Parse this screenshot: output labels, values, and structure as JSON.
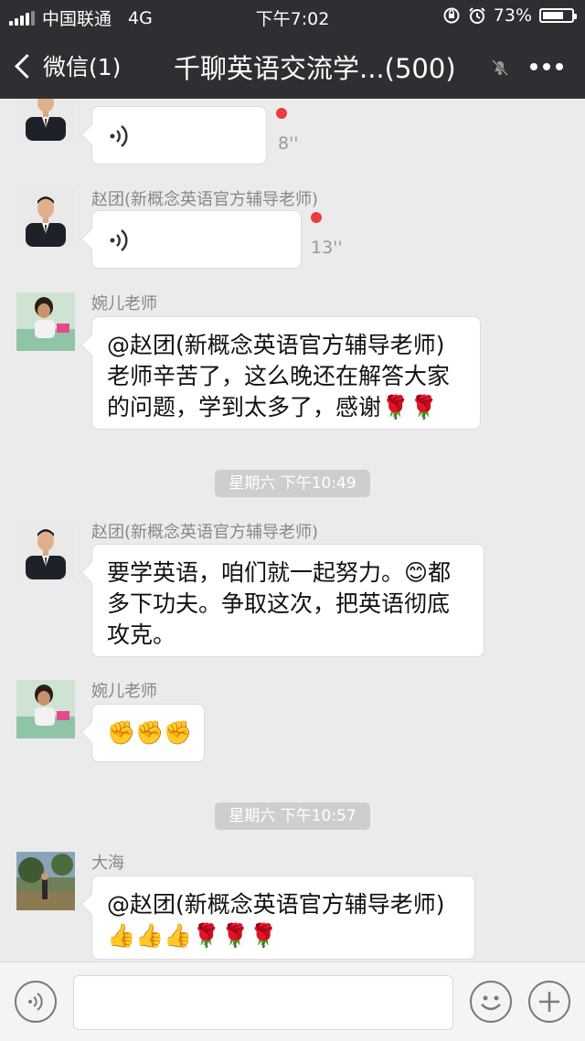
{
  "status_bar": {
    "carrier": "中国联通",
    "network": "4G",
    "time": "下午7:02",
    "battery": "73%",
    "battery_level": 0.73
  },
  "nav": {
    "back_label": "微信(1)",
    "title": "千聊英语交流学...(500)"
  },
  "messages": [
    {
      "type": "voice",
      "duration": "8''",
      "unread": true
    },
    {
      "type": "voice",
      "sender": "赵团(新概念英语官方辅导老师)",
      "duration": "13''",
      "unread": true
    },
    {
      "type": "text",
      "sender": "婉儿老师",
      "lines": [
        "@赵团(新概念英语官方辅导老师)",
        "老师辛苦了，这么晚还在解答大家",
        "的问题，学到太多了，感谢🌹🌹"
      ]
    },
    {
      "type": "timestamp",
      "text": "星期六 下午10:49"
    },
    {
      "type": "text",
      "sender": "赵团(新概念英语官方辅导老师)",
      "lines": [
        "要学英语，咱们就一起努力。😊都",
        "多下功夫。争取这次，把英语彻底",
        "攻克。"
      ]
    },
    {
      "type": "emoji",
      "sender": "婉儿老师",
      "emojis": "✊✊✊"
    },
    {
      "type": "timestamp",
      "text": "星期六 下午10:57"
    },
    {
      "type": "text",
      "sender": "大海",
      "lines": [
        "@赵团(新概念英语官方辅导老师)",
        "👍👍👍🌹🌹🌹"
      ]
    }
  ],
  "input_bar": {
    "voice_icon": "voice-toggle-icon",
    "emoji_icon": "emoji-icon",
    "plus_icon": "plus-icon",
    "message_value": ""
  }
}
